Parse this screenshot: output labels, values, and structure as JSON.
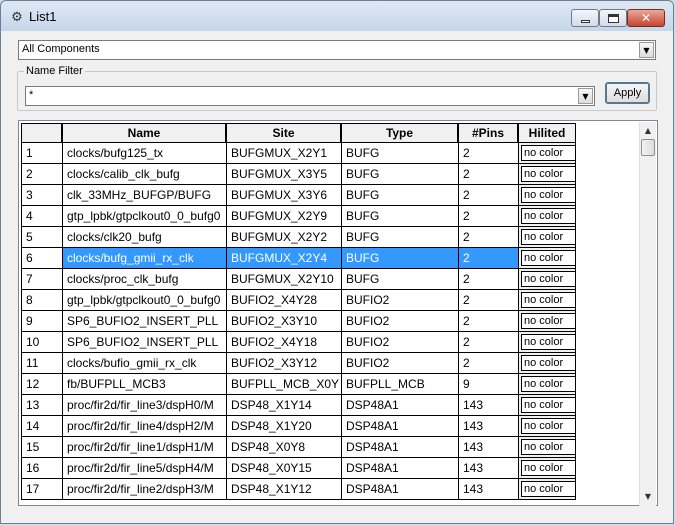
{
  "window": {
    "title": "List1",
    "app_icon": "gear-icon"
  },
  "filter": {
    "components_value": "All Components",
    "name_filter_label": "Name Filter",
    "name_filter_value": "*",
    "apply_label": "Apply"
  },
  "table": {
    "columns": [
      "",
      "Name",
      "Site",
      "Type",
      "#Pins",
      "Hilited"
    ],
    "selected_row": 6,
    "selection_color": "#3399ff",
    "rows": [
      {
        "num": "1",
        "name": "clocks/bufg125_tx",
        "site": "BUFGMUX_X2Y1",
        "type": "BUFG",
        "pins": "2",
        "hilited": "no color"
      },
      {
        "num": "2",
        "name": "clocks/calib_clk_bufg",
        "site": "BUFGMUX_X3Y5",
        "type": "BUFG",
        "pins": "2",
        "hilited": "no color"
      },
      {
        "num": "3",
        "name": "clk_33MHz_BUFGP/BUFG",
        "site": "BUFGMUX_X3Y6",
        "type": "BUFG",
        "pins": "2",
        "hilited": "no color"
      },
      {
        "num": "4",
        "name": "gtp_lpbk/gtpclkout0_0_bufg0",
        "site": "BUFGMUX_X2Y9",
        "type": "BUFG",
        "pins": "2",
        "hilited": "no color"
      },
      {
        "num": "5",
        "name": "clocks/clk20_bufg",
        "site": "BUFGMUX_X2Y2",
        "type": "BUFG",
        "pins": "2",
        "hilited": "no color"
      },
      {
        "num": "6",
        "name": "clocks/bufg_gmii_rx_clk",
        "site": "BUFGMUX_X2Y4",
        "type": "BUFG",
        "pins": "2",
        "hilited": "no color"
      },
      {
        "num": "7",
        "name": "clocks/proc_clk_bufg",
        "site": "BUFGMUX_X2Y10",
        "type": "BUFG",
        "pins": "2",
        "hilited": "no color"
      },
      {
        "num": "8",
        "name": "gtp_lpbk/gtpclkout0_0_bufg0",
        "site": "BUFIO2_X4Y28",
        "type": "BUFIO2",
        "pins": "2",
        "hilited": "no color"
      },
      {
        "num": "9",
        "name": "SP6_BUFIO2_INSERT_PLL",
        "site": "BUFIO2_X3Y10",
        "type": "BUFIO2",
        "pins": "2",
        "hilited": "no color"
      },
      {
        "num": "10",
        "name": "SP6_BUFIO2_INSERT_PLL",
        "site": "BUFIO2_X4Y18",
        "type": "BUFIO2",
        "pins": "2",
        "hilited": "no color"
      },
      {
        "num": "11",
        "name": "clocks/bufio_gmii_rx_clk",
        "site": "BUFIO2_X3Y12",
        "type": "BUFIO2",
        "pins": "2",
        "hilited": "no color"
      },
      {
        "num": "12",
        "name": "fb/BUFPLL_MCB3",
        "site": "BUFPLL_MCB_X0Y",
        "type": "BUFPLL_MCB",
        "pins": "9",
        "hilited": "no color"
      },
      {
        "num": "13",
        "name": "proc/fir2d/fir_line3/dspH0/M",
        "site": "DSP48_X1Y14",
        "type": "DSP48A1",
        "pins": "143",
        "hilited": "no color"
      },
      {
        "num": "14",
        "name": "proc/fir2d/fir_line4/dspH2/M",
        "site": "DSP48_X1Y20",
        "type": "DSP48A1",
        "pins": "143",
        "hilited": "no color"
      },
      {
        "num": "15",
        "name": "proc/fir2d/fir_line1/dspH1/M",
        "site": "DSP48_X0Y8",
        "type": "DSP48A1",
        "pins": "143",
        "hilited": "no color"
      },
      {
        "num": "16",
        "name": "proc/fir2d/fir_line5/dspH4/M",
        "site": "DSP48_X0Y15",
        "type": "DSP48A1",
        "pins": "143",
        "hilited": "no color"
      },
      {
        "num": "17",
        "name": "proc/fir2d/fir_line2/dspH3/M",
        "site": "DSP48_X1Y12",
        "type": "DSP48A1",
        "pins": "143",
        "hilited": "no color"
      }
    ]
  }
}
